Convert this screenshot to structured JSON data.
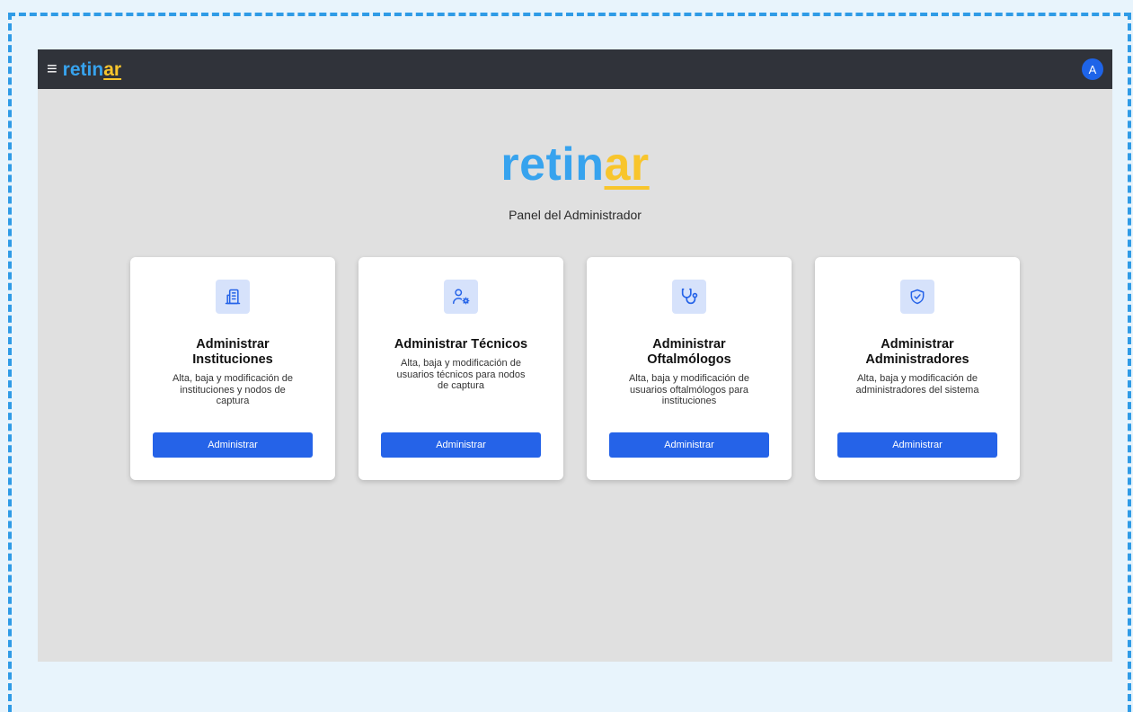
{
  "brand": {
    "part1": "retin",
    "part2": "ar"
  },
  "topbar": {
    "menu_icon": "hamburger-icon",
    "avatar_letter": "A"
  },
  "hero": {
    "subtitle": "Panel del Administrador"
  },
  "cards": [
    {
      "icon": "building-icon",
      "title": "Administrar Instituciones",
      "description": "Alta, baja y modificación de instituciones y nodos de captura",
      "button": "Administrar"
    },
    {
      "icon": "user-gear-icon",
      "title": "Administrar Técnicos",
      "description": "Alta, baja y modificación de usuarios técnicos para nodos de captura",
      "button": "Administrar"
    },
    {
      "icon": "stethoscope-icon",
      "title": "Administrar Oftalmólogos",
      "description": "Alta, baja y modificación de usuarios oftalmólogos para instituciones",
      "button": "Administrar"
    },
    {
      "icon": "shield-check-icon",
      "title": "Administrar Administradores",
      "description": "Alta, baja y modificación de administradores del sistema",
      "button": "Administrar"
    }
  ],
  "colors": {
    "accent": "#2563e8",
    "brand_blue": "#37a3ee",
    "brand_yellow": "#f8c52c",
    "topbar": "#30333a",
    "icon_bg": "#d6e2fb"
  }
}
